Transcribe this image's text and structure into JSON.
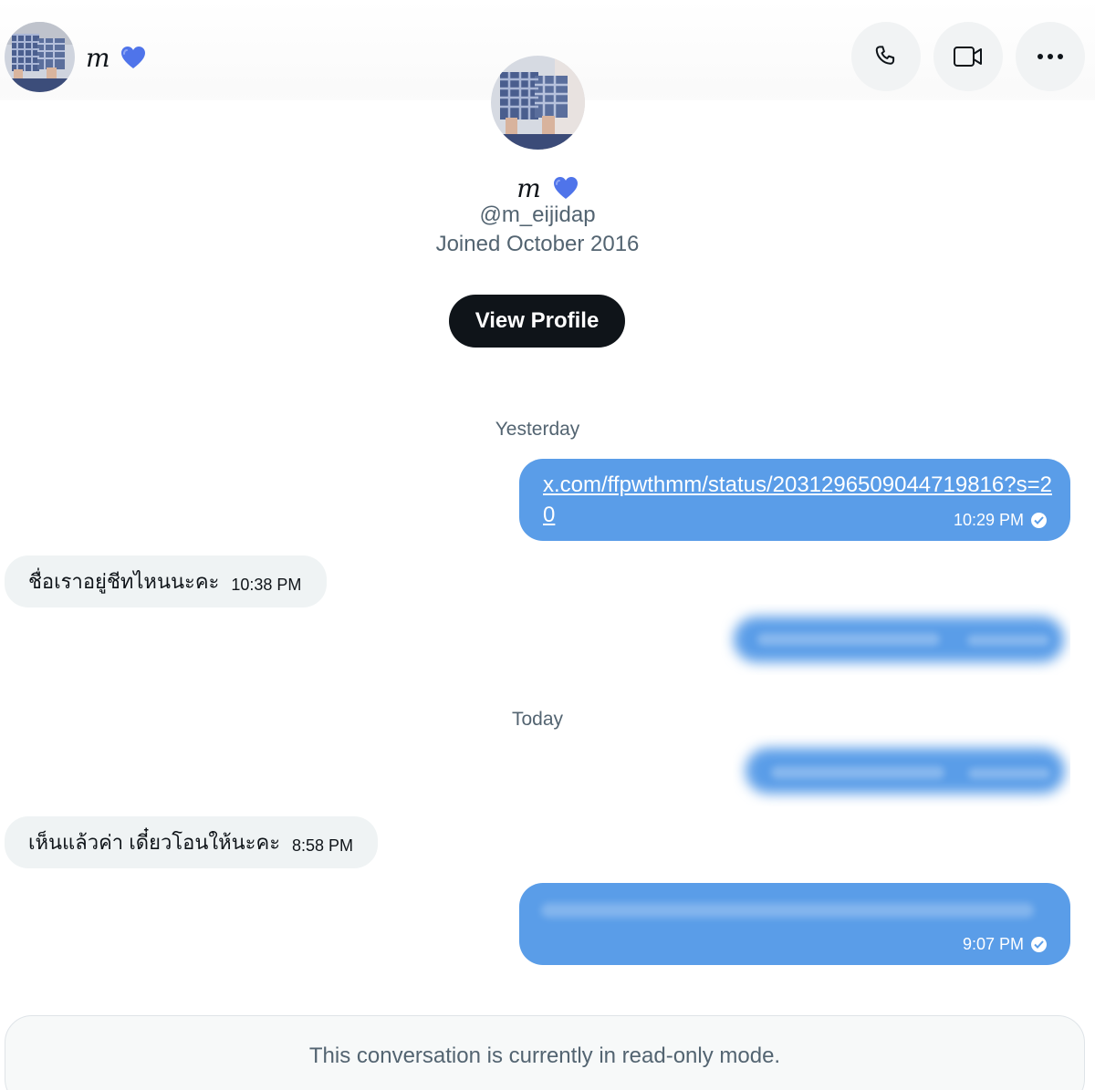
{
  "header": {
    "display_name": "m",
    "badge_icon": "blue-heart-icon",
    "actions": [
      {
        "name": "call-button",
        "icon": "phone-icon"
      },
      {
        "name": "video-call-button",
        "icon": "video-icon"
      },
      {
        "name": "more-options-button",
        "icon": "more-horizontal-icon"
      }
    ]
  },
  "profile": {
    "display_name": "m",
    "handle": "@m_eijidap",
    "joined": "Joined October 2016",
    "view_profile_label": "View Profile"
  },
  "conversation": {
    "sections": [
      {
        "date_label": "Yesterday",
        "messages": [
          {
            "direction": "outgoing",
            "text": "x.com/ffpwthmm/status/2031296509044719816?s=20",
            "is_link": true,
            "time": "10:29 PM",
            "status_icon": "read-check-icon"
          },
          {
            "direction": "incoming",
            "text": "ชื่อเราอยู่ชีทไหนนะคะ",
            "time": "10:38 PM"
          },
          {
            "direction": "outgoing",
            "text": "",
            "blurred": true
          }
        ]
      },
      {
        "date_label": "Today",
        "messages": [
          {
            "direction": "outgoing",
            "text": "",
            "blurred": true
          },
          {
            "direction": "incoming",
            "text": "เห็นแล้วค่า เดี๋ยวโอนให้นะคะ",
            "time": "8:58 PM"
          },
          {
            "direction": "outgoing",
            "text": "",
            "blurred": true,
            "time": "9:07 PM",
            "status_icon": "read-check-icon"
          }
        ]
      }
    ]
  },
  "footer": {
    "readonly_notice": "This conversation is currently in read-only mode."
  },
  "colors": {
    "outgoing_bubble": "#5a9de8",
    "incoming_bubble": "#eff3f4",
    "heart": "#4f74ea",
    "primary_button": "#0f1419"
  }
}
